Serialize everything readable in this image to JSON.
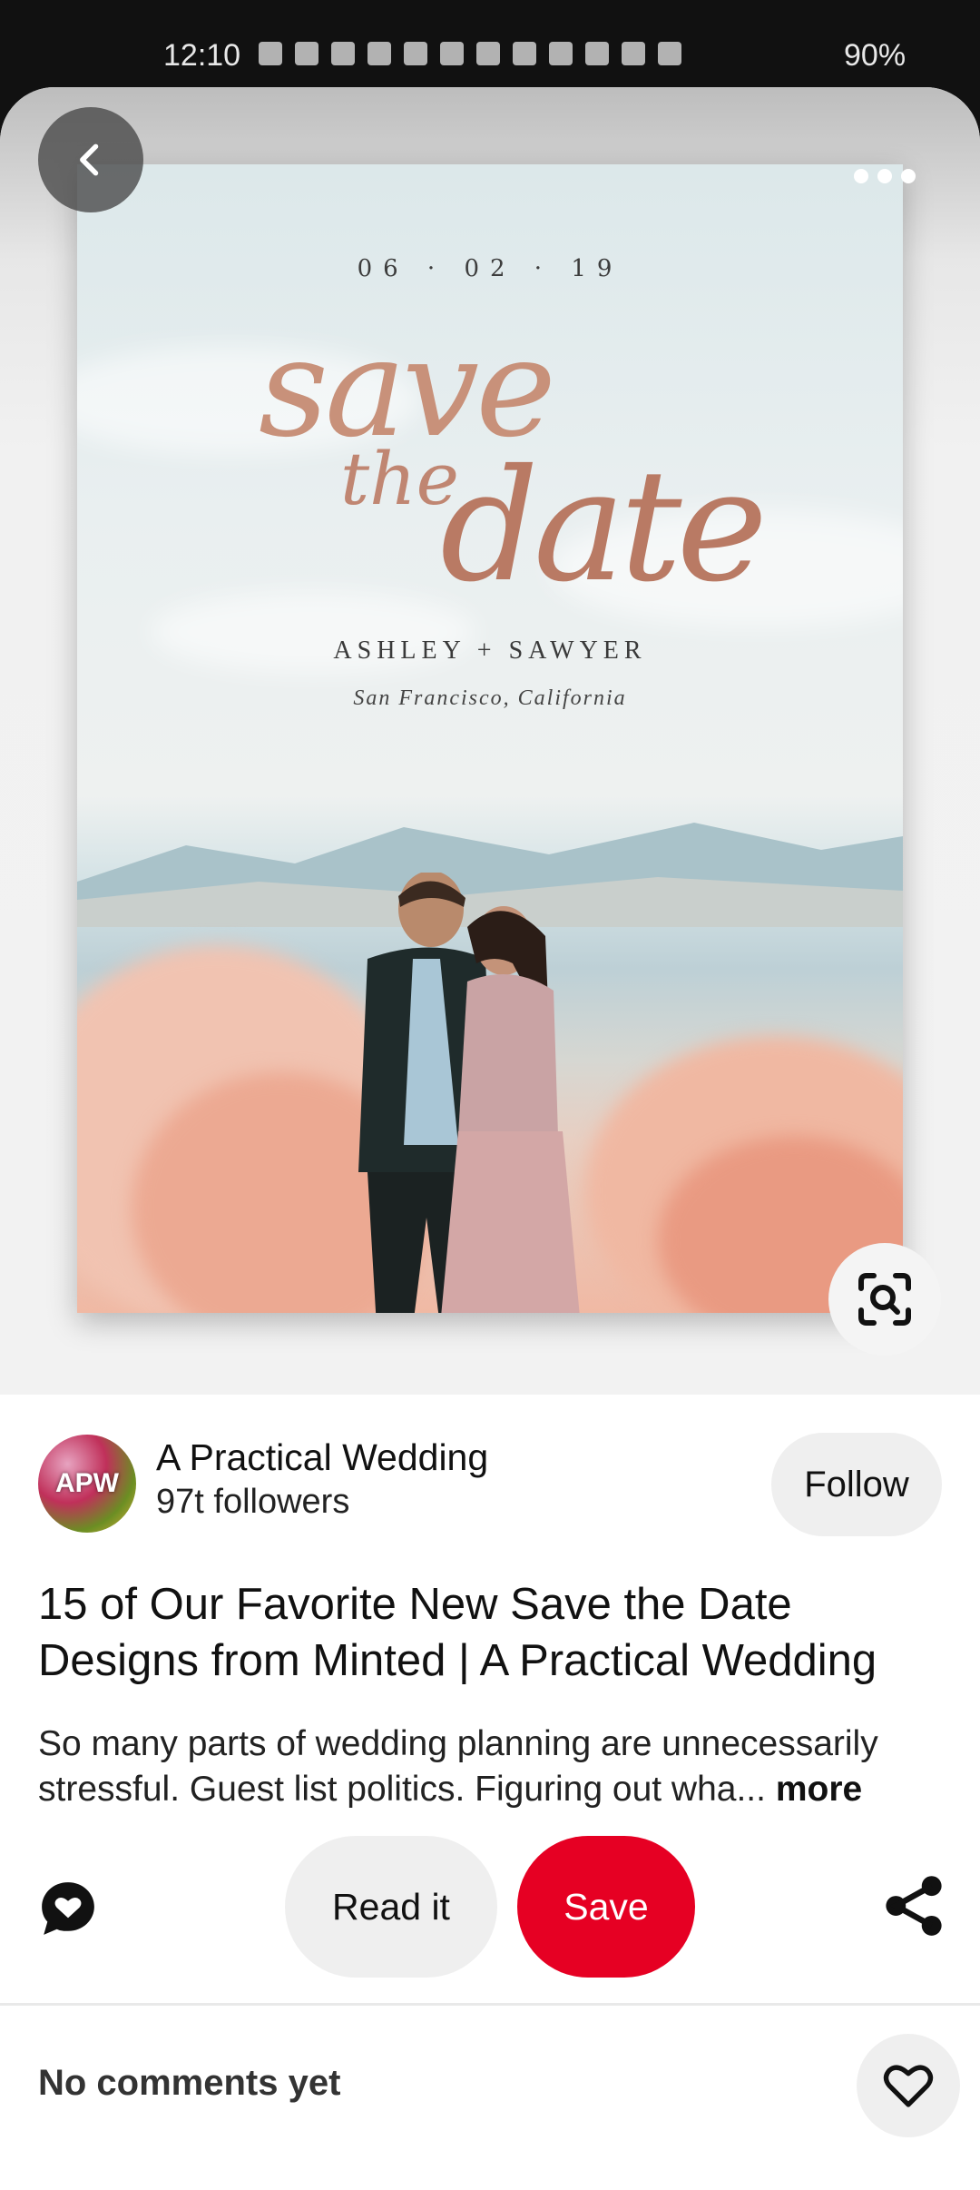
{
  "status_bar": {
    "time": "12:10",
    "battery": "90%"
  },
  "hero": {
    "card_date": "06 · 02 · 19",
    "card_script_save": "save",
    "card_script_the": "the",
    "card_script_date": "date",
    "card_names": "ASHLEY + SAWYER",
    "card_location": "San Francisco, California"
  },
  "icons": {
    "back": "chevron-left-icon",
    "more": "more-dots-icon",
    "visual_search": "visual-search-icon",
    "comment": "comment-icon",
    "share": "share-icon",
    "heart": "heart-icon"
  },
  "creator": {
    "avatar_text": "APW",
    "name": "A Practical Wedding",
    "followers": "97t followers",
    "follow_label": "Follow"
  },
  "pin": {
    "title": "15 of Our Favorite New Save the Date Designs from Minted | A Practical Wedding",
    "description": "So many parts of wedding planning are unnecessarily stressful. Guest list politics. Figuring out wha...",
    "more_label": "more"
  },
  "actions": {
    "read_label": "Read it",
    "save_label": "Save"
  },
  "comments": {
    "empty_label": "No comments yet"
  },
  "colors": {
    "save_red": "#e60023",
    "chip_gray": "#efefef"
  }
}
